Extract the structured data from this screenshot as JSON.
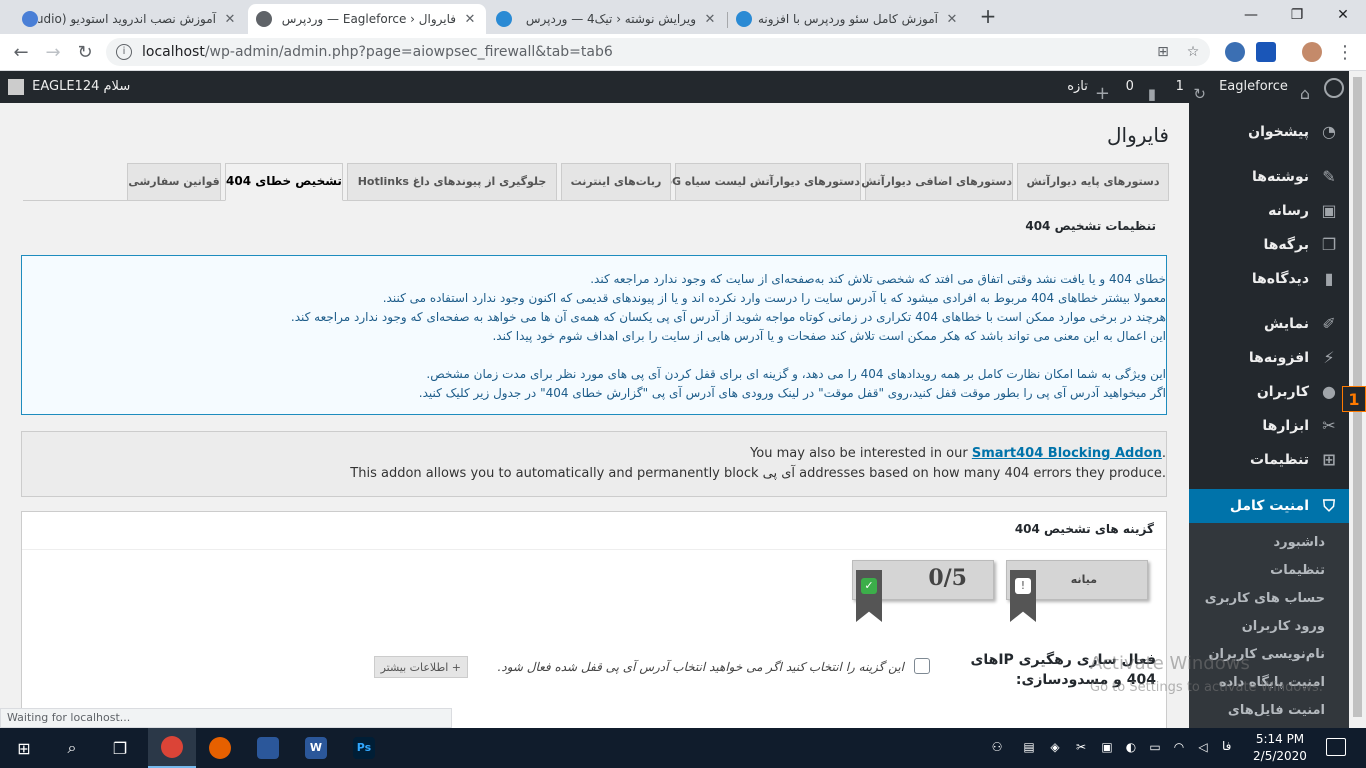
{
  "browser": {
    "tabs": [
      {
        "title": "آموزش نصب اندروید استودیو (studio)"
      },
      {
        "title": "فایروال ‹ Eagleforce — وردپرس"
      },
      {
        "title": "ویرایش نوشته ‹ تیک4 — وردپرس"
      },
      {
        "title": "آموزش کامل سئو وردپرس با افزونه"
      }
    ],
    "url_host": "localhost",
    "url_path": "/wp-admin/admin.php?page=aiowpsec_firewall&tab=tab6",
    "status": "Waiting for localhost..."
  },
  "adminbar": {
    "site_name": "Eagleforce",
    "updates_count": "1",
    "comments_count": "0",
    "new_label": "تازه",
    "greeting": "سلام EAGLE124"
  },
  "sidebar": {
    "items": [
      {
        "label": "پیشخوان"
      },
      {
        "label": "نوشته‌ها"
      },
      {
        "label": "رسانه"
      },
      {
        "label": "برگه‌ها"
      },
      {
        "label": "دیدگاه‌ها"
      },
      {
        "label": "نمایش"
      },
      {
        "label": "افزونه‌ها"
      },
      {
        "label": "کاربران"
      },
      {
        "label": "ابزارها"
      },
      {
        "label": "تنظیمات"
      },
      {
        "label": "امنیت کامل وردپرس"
      }
    ],
    "submenu": [
      {
        "label": "داشبورد"
      },
      {
        "label": "تنظیمات"
      },
      {
        "label": "حساب های کاربری"
      },
      {
        "label": "ورود کاربران"
      },
      {
        "label": "نام‌نویسی کاربران"
      },
      {
        "label": "امنیت پایگاه داده"
      },
      {
        "label": "امنیت فایل‌های سیستم"
      }
    ]
  },
  "page": {
    "title": "فایروال",
    "tabs": [
      {
        "label": "دستورهای پایه دیوارآتش"
      },
      {
        "label": "دستورهای اضافی دیوارآتش"
      },
      {
        "label": "دستورهای دیوارآتش لیست سیاه 6G"
      },
      {
        "label": "ربات‌های اینترنت"
      },
      {
        "label": "جلوگیری از پیوندهای داغ Hotlinks"
      },
      {
        "label": "تشخیص خطای 404"
      },
      {
        "label": "قوانین سفارشی"
      }
    ],
    "section_title": "تنظیمات تشخیص 404",
    "info_lines": [
      "خطای 404 و یا یافت نشد وقتی اتفاق می افتد که شخصی تلاش کند به‌صفحه‌ای از سایت که وجود ندارد مراجعه کند.",
      "معمولا بیشتر خطاهای 404 مربوط به افرادی میشود که یا آدرس سایت را درست وارد نکرده اند و یا از پیوندهای قدیمی که اکنون وجود ندارد استفاده می کنند.",
      "هرچند در برخی موارد ممکن است با خطاهای 404 تکراری در زمانی کوتاه مواجه شوید از آدرس آی پی یکسان که همه‌ی آن ها می خواهد به صفحه‌ای که وجود ندارد مراجعه کند.",
      "این اعمال به این معنی می تواند باشد که هکر ممکن است تلاش کند صفحات و یا آدرس هایی از سایت را برای اهداف شوم خود پیدا کند.",
      "",
      "این ویژگی به شما امکان نظارت کامل بر همه رویدادهای 404 را می دهد، و گزینه ای برای قفل کردن آی پی های مورد نظر برای مدت زمان مشخص.",
      "اگر میخواهید آدرس آی پی را بطور موقت قفل کنید،روی \"قفل موقت\" در لینک ورودی های آدرس آی پی \"گزارش خطای 404\" در جدول زیر کلیک کنید."
    ],
    "addon_prefix": "You may also be interested in our ",
    "addon_link": "Smart404 Blocking Addon",
    "addon_suffix": ".",
    "addon_line2": "This addon allows you to automatically and permanently block آی پی addresses based on how many 404 errors they produce.",
    "options_title": "گزینه های تشخیص 404",
    "badge_level": "میانه",
    "badge_score": "0/5",
    "option_label": "فعال سازی رهگیری IPهای 404 و مسدودسازی:",
    "option_desc": "این گزینه را انتخاب کنید اگر می خواهید انتخاب آدرس آی پی قفل شده فعال شود.",
    "more_info": "+ اطلاعات بیشتر"
  },
  "watermark": {
    "line1": "Activate Windows",
    "line2": "Go to Settings to activate Windows."
  },
  "taskbar": {
    "lang": "فا",
    "time": "5:14 PM",
    "date": "2/5/2020"
  },
  "float_badge": "1",
  "colors": {
    "wp_dark": "#23282d",
    "wp_blue": "#0073aa",
    "info_border": "#1e8cbe"
  }
}
